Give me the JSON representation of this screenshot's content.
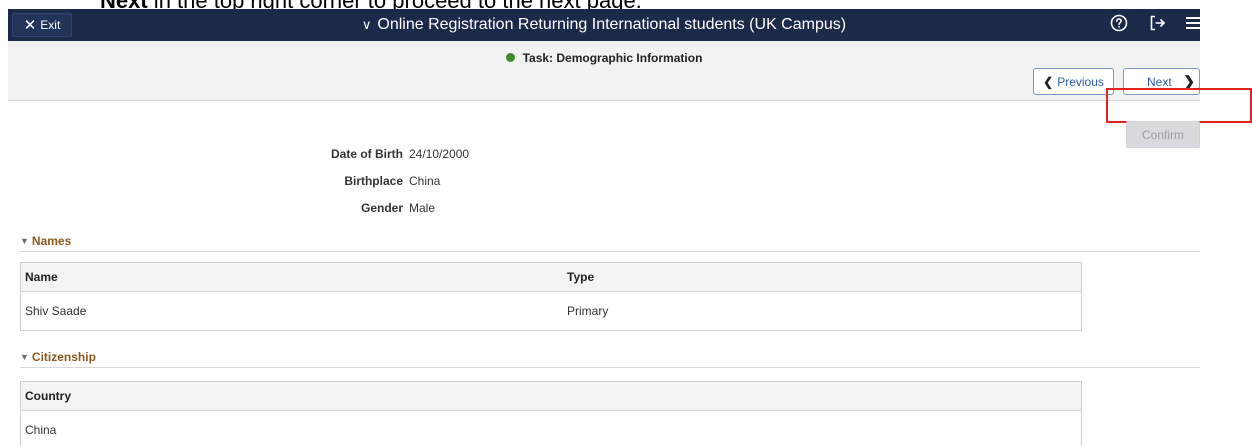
{
  "caption": {
    "bold_part": "Next",
    "rest": " in the top right corner to proceed to the next page."
  },
  "topbar": {
    "exit_label": "Exit",
    "exit_icon": "close-icon",
    "title": "Online Registration Returning International students (UK Campus)",
    "title_icon": "chevron-down-icon",
    "icons": [
      "help-icon",
      "sign-out-icon",
      "menu-icon"
    ],
    "bg_color": "#1b2a49"
  },
  "task": {
    "label": "Task: Demographic Information",
    "status_color": "#3e8a2d"
  },
  "nav": {
    "previous_label": "Previous",
    "next_label": "Next"
  },
  "confirm_label": "Confirm",
  "fields": [
    {
      "label": "Date of Birth",
      "value": "24/10/2000"
    },
    {
      "label": "Birthplace",
      "value": "China"
    },
    {
      "label": "Gender",
      "value": "Male"
    }
  ],
  "names": {
    "title": "Names",
    "columns": [
      "Name",
      "Type"
    ],
    "rows": [
      [
        "Shiv Saade",
        "Primary"
      ]
    ]
  },
  "citizenship": {
    "title": "Citizenship",
    "columns": [
      "Country"
    ],
    "rows": [
      [
        "China"
      ]
    ]
  }
}
